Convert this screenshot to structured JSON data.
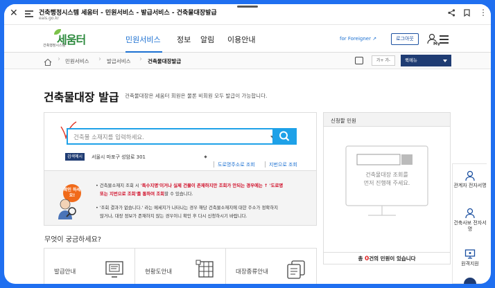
{
  "browser": {
    "title": "건축행정시스템 세움터 - 민원서비스 - 발급서비스 - 건축물대장발급",
    "url": "eais.go.kr"
  },
  "header": {
    "logo_small": "건축행정시스템",
    "logo_main": "세움터",
    "nav": [
      "민원서비스",
      "정보",
      "알림",
      "이용안내"
    ],
    "foreigner": "for Foreigner",
    "logout": "로그아웃",
    "my_label": "My"
  },
  "breadcrumb": {
    "items": [
      "민원서비스",
      "발급서비스",
      "건축물대장발급"
    ],
    "font_size": "가+ 가-",
    "quick_menu": "퀵메뉴"
  },
  "page": {
    "title": "건축물대장 발급",
    "subtitle": "건축물대장은 세움터 회원은 물론 비회원 모두 발급이 가능합니다."
  },
  "search": {
    "placeholder": "건축물 소재지를 입력하세요.",
    "example_badge": "검색예시",
    "example_address": "서울시 마포구 성암로 301",
    "link_road": "도로명주소로 조회",
    "link_lot": "지번으로 조회"
  },
  "notice": {
    "badge": "확인 하세요!",
    "line1a": "• 건축물소재지 조회 시 ",
    "line1b": "'특수지명'이거나 실제 건물이 존재하지만 조회가 안되는 경우에는 ↑ '도로명",
    "line2b": "또는 지번으로 조회'를 통하여 조회",
    "line2c": "할 수 있습니다.",
    "line3": "• '조회 결과가 없습니다.' 라는 메세지가 나타나는 경우 해당 건축물소재지에 대한 주소가 정확하지",
    "line4": "않거나, 대장 정보가 존재하지 않는 경우이니 확인 후 다시 신청하시기 바랍니다."
  },
  "faq": {
    "title": "무엇이 궁금하세요?",
    "cards": [
      "발급안내",
      "현황도안내",
      "대장종류안내"
    ]
  },
  "apply": {
    "title": "신청할 민원",
    "empty_line1": "건축물대장 조회를",
    "empty_line2": "먼저 진행해 주세요.",
    "count_prefix": "총 ",
    "count": "0",
    "count_suffix": "건의 민원이 있습니다"
  },
  "side": {
    "items": [
      "관계자 전자서명",
      "건축사보 전자서명",
      "원격지원"
    ]
  },
  "colors": {
    "accent": "#1a6fd1",
    "search": "#1ea1e8",
    "navy": "#1f3c73",
    "frame": "#1f6ff0"
  }
}
